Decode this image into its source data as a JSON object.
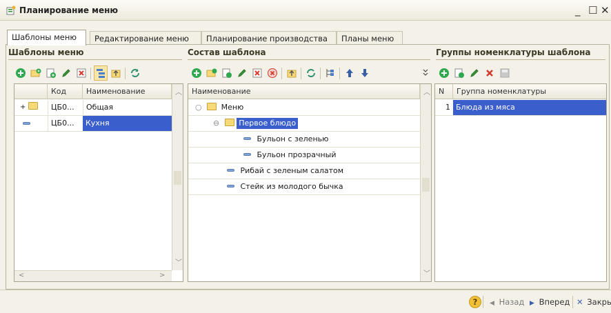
{
  "window": {
    "title": "Планирование меню",
    "minimize": "_",
    "maximize": "☐",
    "close": "✕"
  },
  "tabs": [
    {
      "label": "Шаблоны меню",
      "active": true
    },
    {
      "label": "Редактирование меню",
      "active": false
    },
    {
      "label": "Планирование производства",
      "active": false
    },
    {
      "label": "Планы меню",
      "active": false
    }
  ],
  "panels": {
    "templates": {
      "title": "Шаблоны меню",
      "columns": [
        "Код",
        "Наименование"
      ],
      "rows": [
        {
          "code": "ЦБ0...",
          "name": "Общая",
          "kind": "folder",
          "expand": "+"
        },
        {
          "code": "ЦБ0...",
          "name": "Кухня",
          "kind": "item",
          "selected": true
        }
      ]
    },
    "composition": {
      "title": "Состав шаблона",
      "columns": [
        "Наименование"
      ],
      "rows": [
        {
          "name": "Меню",
          "kind": "folder",
          "expand": "○",
          "level": 0
        },
        {
          "name": "Первое блюдо",
          "kind": "folder",
          "expand": "⊖",
          "level": 1,
          "selected": true
        },
        {
          "name": "Бульон с зеленью",
          "kind": "item",
          "level": 2
        },
        {
          "name": "Бульон прозрачный",
          "kind": "item",
          "level": 2
        },
        {
          "name": "Рибай с зеленым салатом",
          "kind": "item",
          "level": 1
        },
        {
          "name": "Стейк из молодого бычка",
          "kind": "item",
          "level": 1
        }
      ]
    },
    "groups": {
      "title": "Группы номенклатуры шаблона",
      "columns": [
        "N",
        "Группа номенклатуры"
      ],
      "rows": [
        {
          "n": "1",
          "name": "Блюда из мяса",
          "selected": true
        }
      ]
    }
  },
  "statusbar": {
    "help": "?",
    "back": "Назад",
    "forward": "Вперед",
    "close": "Закрыть"
  },
  "colors": {
    "selection": "#3a5fcd",
    "add": "#2fa84f",
    "delete": "#d23a2a",
    "pencil": "#3c9a3c"
  }
}
